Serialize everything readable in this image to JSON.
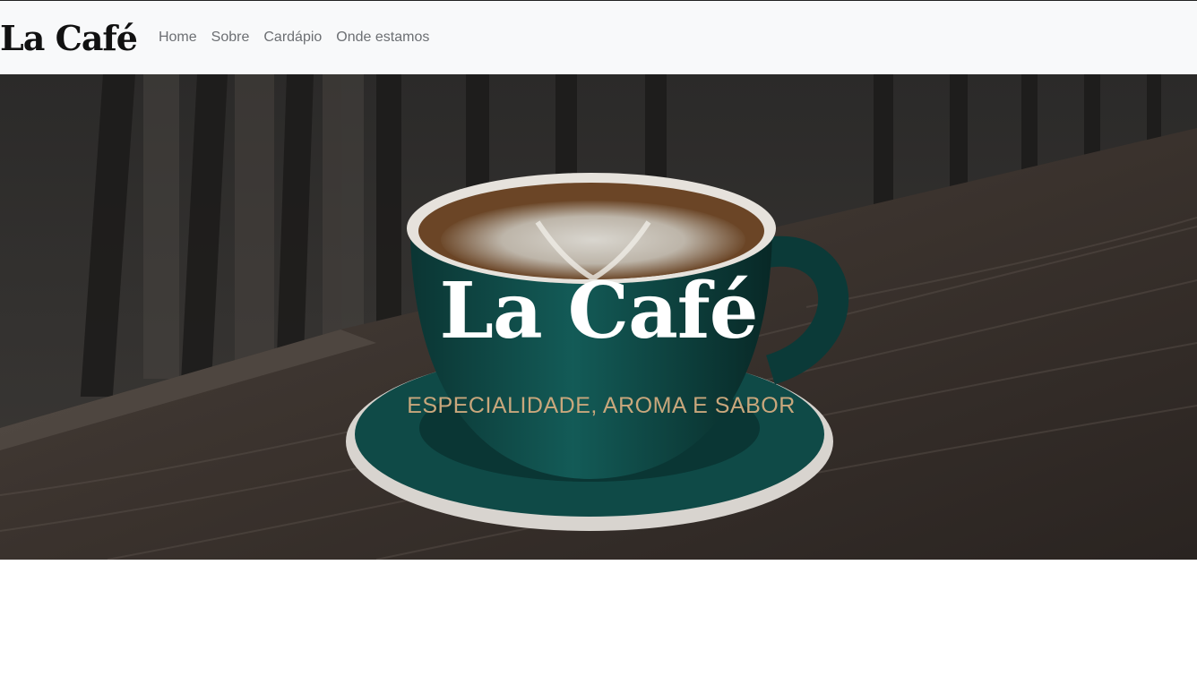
{
  "navbar": {
    "brand": "La Café",
    "links": [
      {
        "label": "Home"
      },
      {
        "label": "Sobre"
      },
      {
        "label": "Cardápio"
      },
      {
        "label": "Onde estamos"
      }
    ]
  },
  "hero": {
    "title": "La Café",
    "subtitle": "ESPECIALIDADE, AROMA E SABOR",
    "image": "coffee-cup-photo",
    "colors": {
      "title": "#ffffff",
      "subtitle": "#c9a77c",
      "cup": "#0f4a47",
      "table": "#3b3430"
    }
  }
}
